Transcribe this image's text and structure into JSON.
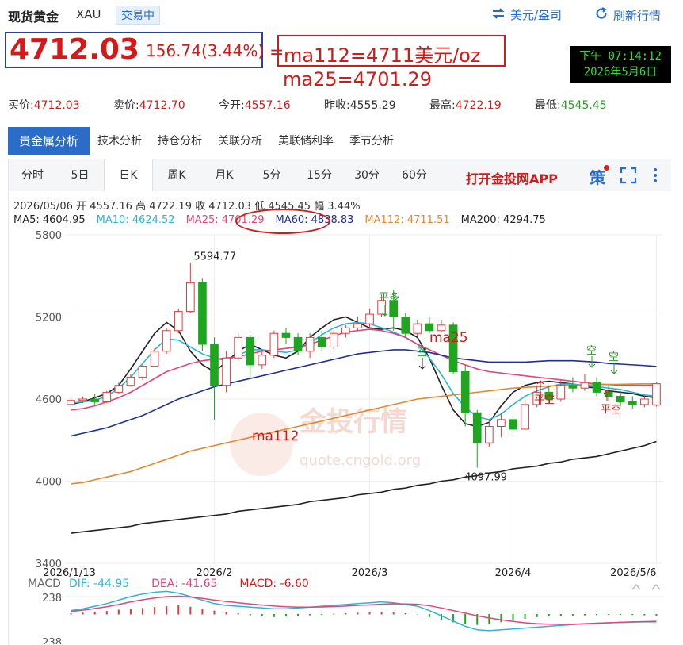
{
  "header": {
    "title": "现货黄金",
    "code": "XAU",
    "status_badge": "交易中",
    "link_unit": "美元/盎司",
    "link_refresh": "刷新行情"
  },
  "price": {
    "current": "4712.03",
    "change": "156.74(3.44%)",
    "equal_sign": "=",
    "ma112_note": "ma112=4711美元/oz",
    "ma25_note": "ma25=4701.29"
  },
  "clock": {
    "time": "下午 07:14:12",
    "date": "2026年5月6日"
  },
  "quotes": [
    {
      "label": "买价:",
      "value": "4712.03",
      "color": "red"
    },
    {
      "label": "卖价:",
      "value": "4712.70",
      "color": "red"
    },
    {
      "label": "今开:",
      "value": "4557.16",
      "color": "red"
    },
    {
      "label": "昨收:",
      "value": "4555.29",
      "color": "normal"
    },
    {
      "label": "最高:",
      "value": "4722.19",
      "color": "red"
    },
    {
      "label": "最低:",
      "value": "4545.45",
      "color": "green"
    }
  ],
  "analysis_tabs": [
    "贵金属分析",
    "技术分析",
    "持仓分析",
    "关联分析",
    "美联储利率",
    "季节分析"
  ],
  "period_tabs": [
    "分时",
    "5日",
    "日K",
    "周K",
    "月K",
    "5分",
    "15分",
    "30分",
    "60分"
  ],
  "app_link": "打开金投网APP",
  "strategy_label": "策",
  "ohlc_line": "2026/05/06  开 4557.16  高 4722.19  收 4712.03  低 4545.45  幅 3.44%",
  "ma_values": [
    {
      "label": "MA5: 4604.95",
      "color": "#222222"
    },
    {
      "label": "MA10: 4624.52",
      "color": "#29b6d8"
    },
    {
      "label": "MA25: 4701.29",
      "color": "#e0457b"
    },
    {
      "label": "MA60: 4838.83",
      "color": "#1f2f9a"
    },
    {
      "label": "MA112: 4711.51",
      "color": "#e08a2e"
    },
    {
      "label": "MA200: 4294.75",
      "color": "#222222"
    }
  ],
  "chart_data": {
    "type": "candlestick",
    "y_ticks": [
      "5800",
      "5200",
      "4600",
      "4000",
      "3400"
    ],
    "ylim": [
      3400,
      5800
    ],
    "x_ticks": [
      "2026/1/13",
      "2026/2",
      "2026/3",
      "2026/4",
      "2026/5/6"
    ],
    "annotations": {
      "high": "5594.77",
      "low": "4097.99",
      "signal_long": "平多",
      "signal_short_1": "空",
      "signal_short_2": "空",
      "signal_short_3": "空",
      "signal_cover_1": "平空",
      "signal_cover_2": "平空",
      "label_ma25": "ma25",
      "label_ma112": "ma112",
      "watermark_cn": "金投行情",
      "watermark_en": "quote.cngold.org"
    },
    "ma_series": [
      {
        "name": "MA5",
        "color": "#222222",
        "values": [
          4560,
          4580,
          4610,
          4640,
          4700,
          4820,
          4950,
          5080,
          5160,
          5100,
          4950,
          4850,
          4800,
          4870,
          4950,
          5000,
          4960,
          4920,
          4900,
          4950,
          5050,
          5120,
          5180,
          5200,
          5160,
          5120,
          5110,
          5120,
          5100,
          5050,
          4900,
          4700,
          4520,
          4420,
          4400,
          4430,
          4550,
          4650,
          4700,
          4720,
          4730,
          4720,
          4710,
          4690,
          4680,
          4660,
          4650,
          4640,
          4620,
          4610
        ]
      },
      {
        "name": "MA10",
        "color": "#29b6d8",
        "values": [
          4570,
          4580,
          4590,
          4620,
          4680,
          4760,
          4860,
          4960,
          5040,
          5030,
          4980,
          4930,
          4900,
          4880,
          4920,
          4960,
          4960,
          4950,
          4940,
          4960,
          5010,
          5070,
          5120,
          5150,
          5160,
          5150,
          5120,
          5090,
          5050,
          5000,
          4900,
          4780,
          4640,
          4540,
          4470,
          4450,
          4490,
          4560,
          4620,
          4660,
          4690,
          4710,
          4710,
          4700,
          4690,
          4680,
          4670,
          4650,
          4630,
          4620
        ]
      },
      {
        "name": "MA25",
        "color": "#e0457b",
        "values": [
          4520,
          4530,
          4550,
          4580,
          4610,
          4650,
          4700,
          4750,
          4800,
          4830,
          4860,
          4880,
          4890,
          4900,
          4910,
          4930,
          4950,
          4960,
          4970,
          4980,
          5000,
          5030,
          5060,
          5090,
          5100,
          5110,
          5100,
          5080,
          5050,
          5000,
          4960,
          4920,
          4880,
          4850,
          4820,
          4800,
          4790,
          4780,
          4770,
          4760,
          4750,
          4740,
          4730,
          4720,
          4710,
          4705,
          4702,
          4701,
          4700,
          4701
        ]
      },
      {
        "name": "MA60",
        "color": "#1f2f9a",
        "values": [
          4330,
          4350,
          4370,
          4390,
          4420,
          4450,
          4480,
          4520,
          4560,
          4600,
          4630,
          4660,
          4690,
          4710,
          4730,
          4750,
          4770,
          4790,
          4810,
          4830,
          4850,
          4870,
          4890,
          4910,
          4930,
          4940,
          4950,
          4960,
          4960,
          4950,
          4940,
          4920,
          4900,
          4890,
          4880,
          4870,
          4870,
          4870,
          4870,
          4875,
          4880,
          4880,
          4880,
          4875,
          4870,
          4860,
          4855,
          4850,
          4845,
          4838
        ]
      },
      {
        "name": "MA112",
        "color": "#e08a2e",
        "values": [
          3980,
          3990,
          4010,
          4030,
          4050,
          4070,
          4100,
          4130,
          4160,
          4190,
          4220,
          4240,
          4260,
          4280,
          4300,
          4320,
          4340,
          4360,
          4380,
          4400,
          4420,
          4440,
          4460,
          4480,
          4500,
          4520,
          4540,
          4560,
          4580,
          4600,
          4610,
          4620,
          4630,
          4640,
          4650,
          4660,
          4670,
          4680,
          4685,
          4690,
          4695,
          4700,
          4700,
          4702,
          4705,
          4707,
          4708,
          4710,
          4711,
          4711
        ]
      },
      {
        "name": "MA200",
        "color": "#222222",
        "values": [
          3620,
          3630,
          3640,
          3650,
          3660,
          3670,
          3690,
          3700,
          3710,
          3720,
          3730,
          3740,
          3750,
          3760,
          3780,
          3790,
          3800,
          3810,
          3820,
          3830,
          3850,
          3860,
          3870,
          3880,
          3900,
          3910,
          3920,
          3940,
          3950,
          3970,
          3980,
          4000,
          4010,
          4030,
          4040,
          4060,
          4070,
          4090,
          4100,
          4110,
          4130,
          4140,
          4160,
          4170,
          4180,
          4200,
          4220,
          4240,
          4260,
          4290
        ]
      }
    ],
    "candles": [
      [
        4560,
        4590,
        4610,
        4550
      ],
      [
        4590,
        4600,
        4620,
        4570
      ],
      [
        4600,
        4580,
        4640,
        4560
      ],
      [
        4580,
        4650,
        4660,
        4570
      ],
      [
        4650,
        4700,
        4720,
        4640
      ],
      [
        4700,
        4760,
        4780,
        4690
      ],
      [
        4760,
        4840,
        4850,
        4740
      ],
      [
        4840,
        4950,
        4970,
        4830
      ],
      [
        4950,
        5100,
        5120,
        4930
      ],
      [
        5100,
        5240,
        5260,
        5080
      ],
      [
        5240,
        5450,
        5594.77,
        5230
      ],
      [
        5450,
        5000,
        5480,
        4950
      ],
      [
        5000,
        4700,
        5050,
        4450
      ],
      [
        4700,
        4900,
        4950,
        4650
      ],
      [
        4900,
        5050,
        5080,
        4880
      ],
      [
        5050,
        4850,
        5070,
        4750
      ],
      [
        4850,
        4920,
        4960,
        4820
      ],
      [
        4920,
        5080,
        5100,
        4900
      ],
      [
        5080,
        5050,
        5120,
        5000
      ],
      [
        5050,
        4950,
        5080,
        4920
      ],
      [
        4950,
        5050,
        5080,
        4900
      ],
      [
        5050,
        4980,
        5100,
        4950
      ],
      [
        4980,
        5080,
        5100,
        4960
      ],
      [
        5080,
        5120,
        5140,
        5050
      ],
      [
        5120,
        5150,
        5200,
        5100
      ],
      [
        5150,
        5220,
        5260,
        5120
      ],
      [
        5220,
        5320,
        5350,
        5200
      ],
      [
        5320,
        5200,
        5400,
        5100
      ],
      [
        5200,
        5080,
        5230,
        5050
      ],
      [
        5080,
        5150,
        5180,
        5060
      ],
      [
        5150,
        5100,
        5200,
        5080
      ],
      [
        5100,
        5140,
        5180,
        5090
      ],
      [
        5140,
        4800,
        5160,
        4780
      ],
      [
        4800,
        4500,
        4850,
        4400
      ],
      [
        4500,
        4280,
        4520,
        4097.99
      ],
      [
        4280,
        4400,
        4450,
        4250
      ],
      [
        4400,
        4450,
        4500,
        4320
      ],
      [
        4450,
        4380,
        4480,
        4350
      ],
      [
        4380,
        4560,
        4600,
        4370
      ],
      [
        4560,
        4650,
        4700,
        4540
      ],
      [
        4650,
        4600,
        4700,
        4570
      ],
      [
        4600,
        4700,
        4740,
        4580
      ],
      [
        4700,
        4680,
        4760,
        4650
      ],
      [
        4680,
        4720,
        4780,
        4660
      ],
      [
        4720,
        4650,
        4760,
        4620
      ],
      [
        4650,
        4620,
        4700,
        4580
      ],
      [
        4620,
        4580,
        4660,
        4550
      ],
      [
        4580,
        4560,
        4620,
        4530
      ],
      [
        4560,
        4600,
        4620,
        4540
      ],
      [
        4557.16,
        4712.03,
        4722.19,
        4545.45
      ]
    ]
  },
  "macd": {
    "label": "MACD",
    "dif": "DIF: -44.95",
    "dea": "DEA: -41.65",
    "macd": "MACD: -6.60",
    "tick_top": "238",
    "tick_bottom": "238",
    "dif_color": "#29b6d8",
    "dea_color": "#e0457b",
    "macd_color": "#d11a1a",
    "hist": [
      5,
      8,
      12,
      18,
      25,
      30,
      35,
      40,
      45,
      50,
      42,
      30,
      20,
      10,
      5,
      -5,
      -10,
      -15,
      -12,
      -8,
      -5,
      -3,
      2,
      5,
      8,
      10,
      12,
      10,
      5,
      0,
      -15,
      -30,
      -45,
      -55,
      -60,
      -55,
      -45,
      -35,
      -25,
      -15,
      -10,
      -8,
      -6,
      -5,
      -4,
      -3,
      -2,
      -3,
      -5,
      -6.6
    ],
    "dif_values": [
      20,
      30,
      45,
      60,
      80,
      100,
      115,
      125,
      130,
      120,
      100,
      80,
      60,
      50,
      45,
      40,
      35,
      30,
      30,
      35,
      40,
      45,
      50,
      55,
      60,
      65,
      70,
      65,
      55,
      45,
      20,
      -10,
      -40,
      -70,
      -90,
      -95,
      -90,
      -85,
      -80,
      -75,
      -70,
      -65,
      -60,
      -55,
      -52,
      -50,
      -48,
      -46,
      -45,
      -44.95
    ],
    "dea_values": [
      15,
      22,
      32,
      42,
      55,
      70,
      82,
      92,
      100,
      102,
      98,
      90,
      80,
      72,
      65,
      58,
      52,
      46,
      42,
      40,
      40,
      41,
      43,
      46,
      50,
      53,
      57,
      59,
      58,
      56,
      48,
      35,
      20,
      5,
      -10,
      -22,
      -33,
      -42,
      -50,
      -55,
      -58,
      -59,
      -58,
      -56,
      -53,
      -50,
      -47,
      -45,
      -43,
      -41.65
    ]
  }
}
